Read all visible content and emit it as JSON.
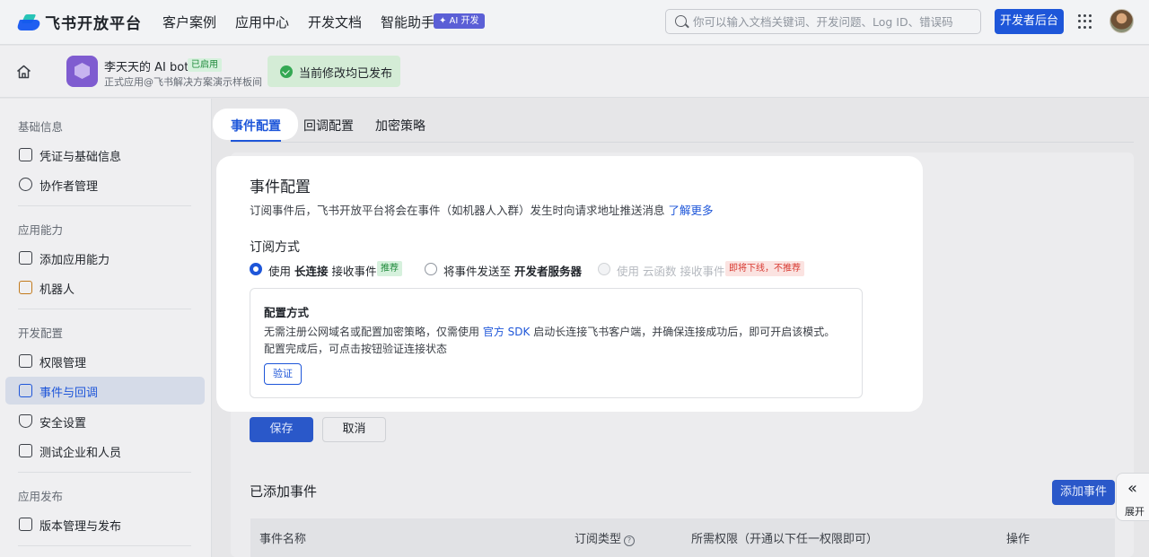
{
  "topnav": {
    "brand": "飞书开放平台",
    "items": [
      "客户案例",
      "应用中心",
      "开发文档",
      "智能助手"
    ],
    "ai_badge": "✦ AI 开发",
    "search_placeholder": "你可以输入文档关键词、开发问题、Log ID、错误码",
    "dev_console": "开发者后台"
  },
  "app": {
    "name": "李天天的 AI bot",
    "status": "已启用",
    "subtitle": "正式应用@飞书解决方案演示样板间",
    "toast": "当前修改均已发布"
  },
  "sidebar": {
    "groups": [
      {
        "title": "基础信息",
        "items": [
          "凭证与基础信息",
          "协作者管理"
        ]
      },
      {
        "title": "应用能力",
        "items": [
          "添加应用能力",
          "机器人"
        ]
      },
      {
        "title": "开发配置",
        "items": [
          "权限管理",
          "事件与回调",
          "安全设置",
          "测试企业和人员"
        ]
      },
      {
        "title": "应用发布",
        "items": [
          "版本管理与发布"
        ]
      }
    ],
    "active": "事件与回调"
  },
  "tabs": [
    "事件配置",
    "回调配置",
    "加密策略"
  ],
  "event_config": {
    "title": "事件配置",
    "desc": "订阅事件后，飞书开放平台将会在事件（如机器人入群）发生时向请求地址推送消息 ",
    "learn_more": "了解更多",
    "subscribe_title": "订阅方式",
    "option1_pre": "使用 ",
    "option1_bold": "长连接",
    "option1_post": " 接收事件",
    "option1_tag": "推荐",
    "option2_pre": "将事件发送至 ",
    "option2_bold": "开发者服务器",
    "option3": "使用 云函数 接收事件",
    "option3_tag": "即将下线，不推荐",
    "method_title": "配置方式",
    "method_text_1": "无需注册公网域名或配置加密策略，仅需使用 ",
    "method_link": "官方 SDK",
    "method_text_2": " 启动长连接飞书客户端，并确保连接成功后，即可开启该模式。",
    "method_text_3": "配置完成后，可点击按钮验证连接状态",
    "verify": "验证"
  },
  "actions": {
    "save": "保存",
    "cancel": "取消"
  },
  "added_events": {
    "title": "已添加事件",
    "add_button": "添加事件",
    "columns": [
      "事件名称",
      "订阅类型",
      "所需权限（开通以下任一权限即可）",
      "操作"
    ]
  },
  "expand": {
    "icon": "«",
    "label": "展开"
  },
  "colors": {
    "accent": "#1e56d9",
    "success": "#34a853",
    "warning_tag": "#d83931"
  }
}
